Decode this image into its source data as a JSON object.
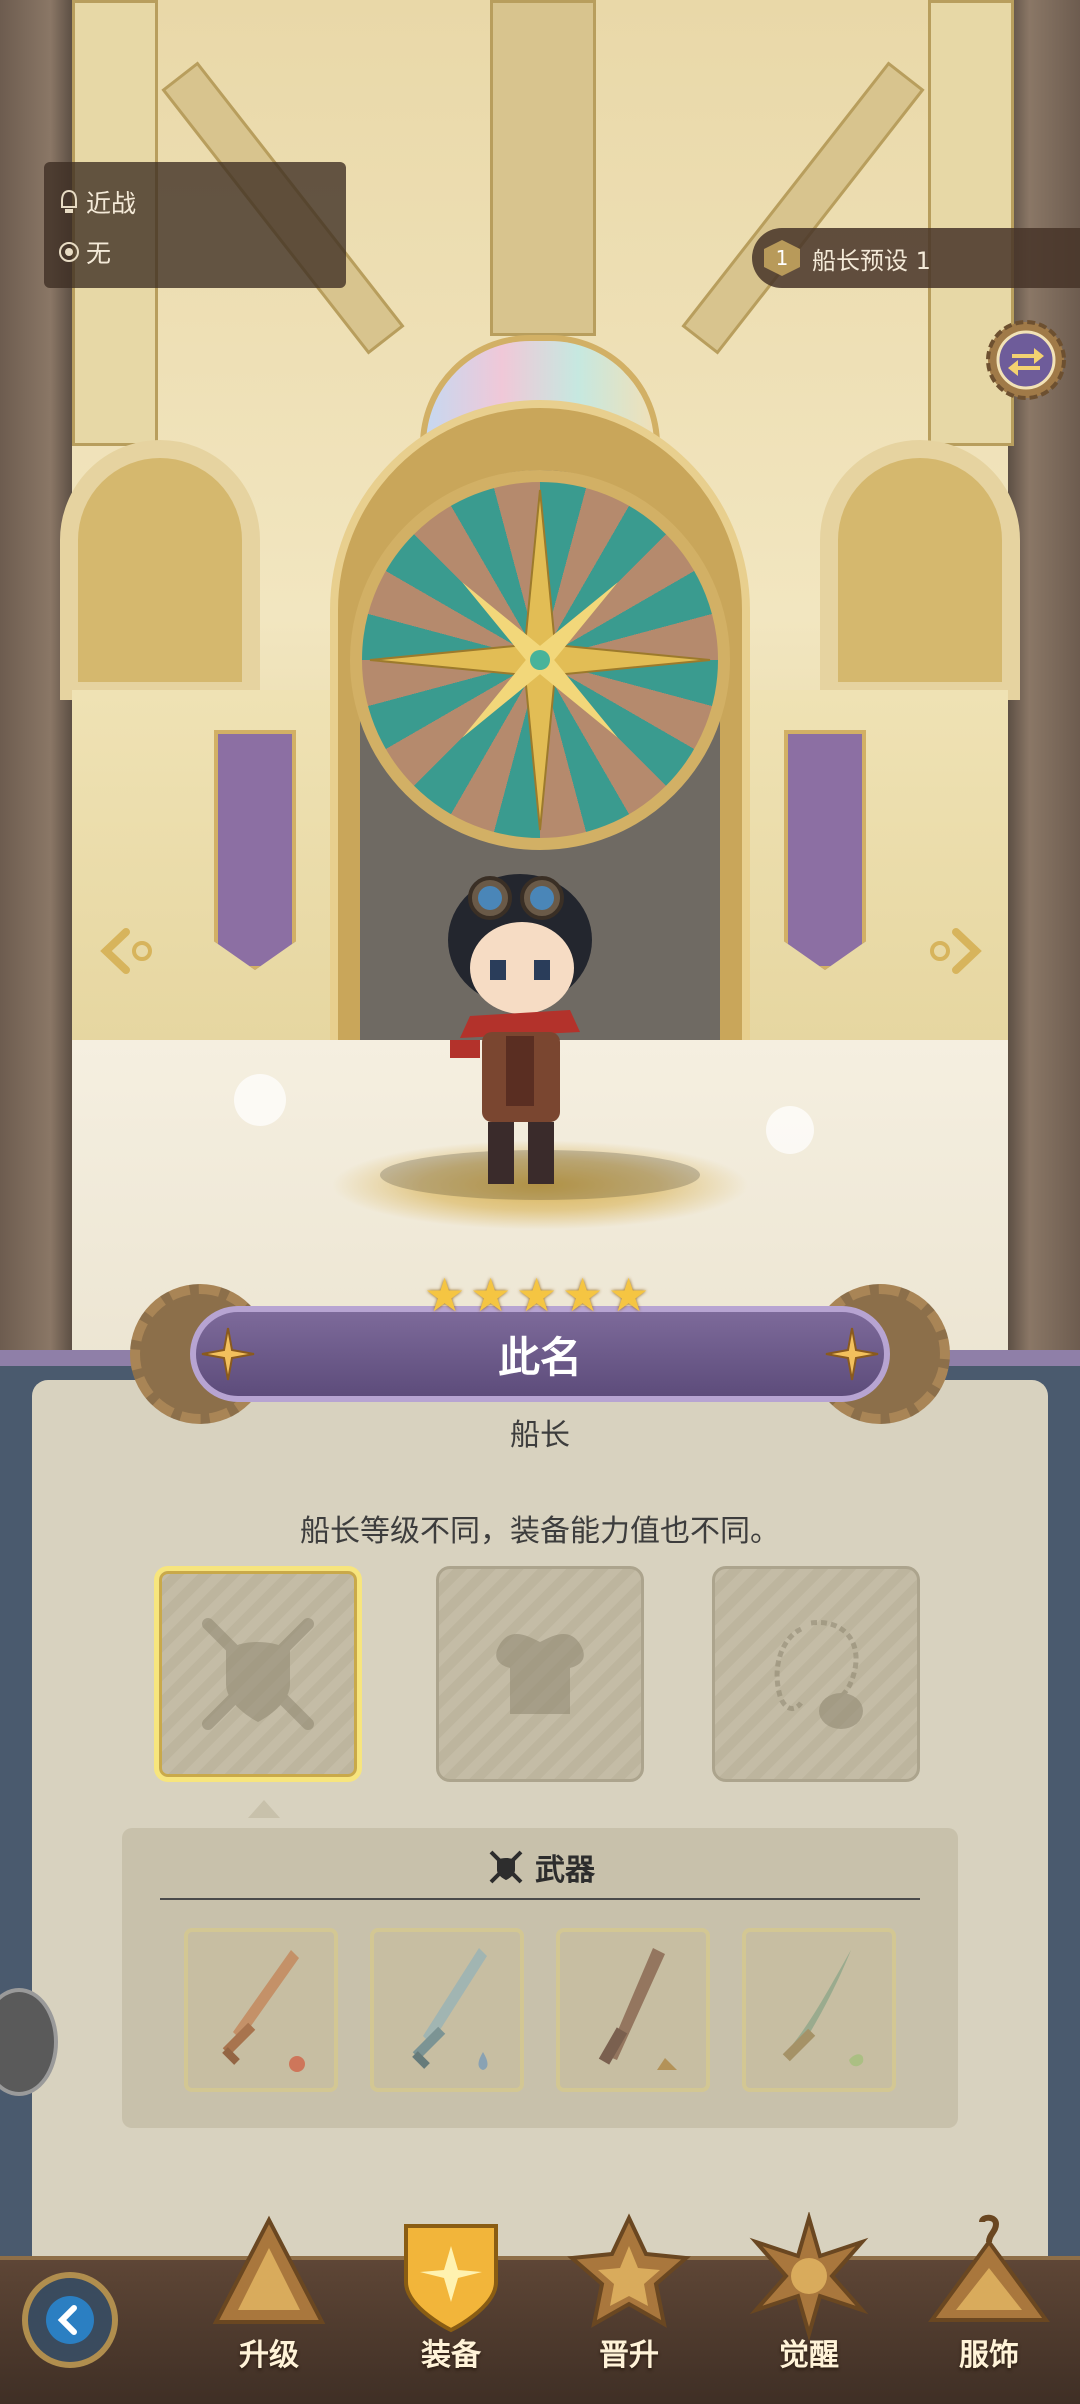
{
  "info": {
    "attack_type": "近战",
    "element": "无"
  },
  "preset": {
    "number": "1",
    "label": "船长预设 1"
  },
  "character": {
    "name": "此名",
    "role": "船长",
    "stars": 5
  },
  "description": "船长等级不同，装备能力值也不同。",
  "equipment_slots": [
    {
      "name": "weapon-slot",
      "icon": "crossed-swords-shield-icon",
      "selected": true
    },
    {
      "name": "armor-slot",
      "icon": "armor-icon",
      "selected": false
    },
    {
      "name": "accessory-slot",
      "icon": "necklace-icon",
      "selected": false
    }
  ],
  "weapon_section": {
    "title": "武器",
    "items": [
      {
        "icon": "fire-sword-icon"
      },
      {
        "icon": "water-sword-icon"
      },
      {
        "icon": "earth-sword-icon"
      },
      {
        "icon": "wind-sword-icon"
      }
    ]
  },
  "nav": {
    "items": [
      {
        "label": "升级",
        "icon": "upgrade-icon"
      },
      {
        "label": "装备",
        "icon": "equipment-icon",
        "active": true
      },
      {
        "label": "晋升",
        "icon": "promote-icon"
      },
      {
        "label": "觉醒",
        "icon": "awaken-icon"
      },
      {
        "label": "服饰",
        "icon": "costume-icon"
      }
    ]
  },
  "colors": {
    "star": "#f5c542",
    "name_plate": "#6b5a8a",
    "panel_bg": "#d8d2bf",
    "nav_bg": "#4a3528"
  }
}
